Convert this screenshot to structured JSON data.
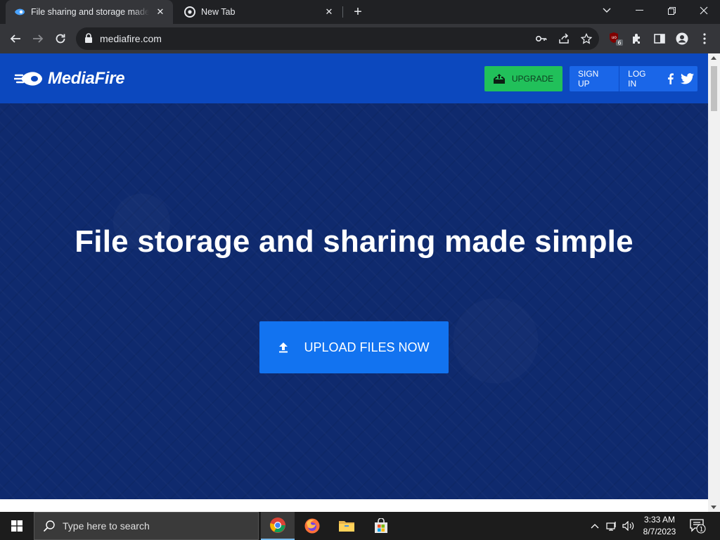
{
  "browser": {
    "tabs": [
      {
        "title": "File sharing and storage made simple",
        "active": true,
        "icon": "mediafire-favicon"
      },
      {
        "title": "New Tab",
        "active": false,
        "icon": "chrome-favicon"
      }
    ],
    "new_tab_label": "+",
    "address": "mediafire.com",
    "extension_badge": "6"
  },
  "site": {
    "logo_text": "MediaFire",
    "nav": {
      "upgrade": "UPGRADE",
      "sign_up": "SIGN UP",
      "log_in": "LOG IN"
    },
    "hero": {
      "title": "File storage and sharing made simple",
      "upload_button": "UPLOAD FILES NOW"
    },
    "colors": {
      "header": "#0c48be",
      "hero_bg": "#0f2a6e",
      "upgrade": "#21c05a",
      "cta": "#1273f0"
    }
  },
  "taskbar": {
    "search_placeholder": "Type here to search",
    "time": "3:33 AM",
    "date": "8/7/2023",
    "notification_count": "1",
    "pinned": [
      "chrome-icon",
      "firefox-icon",
      "file-explorer-icon",
      "microsoft-store-icon"
    ]
  }
}
